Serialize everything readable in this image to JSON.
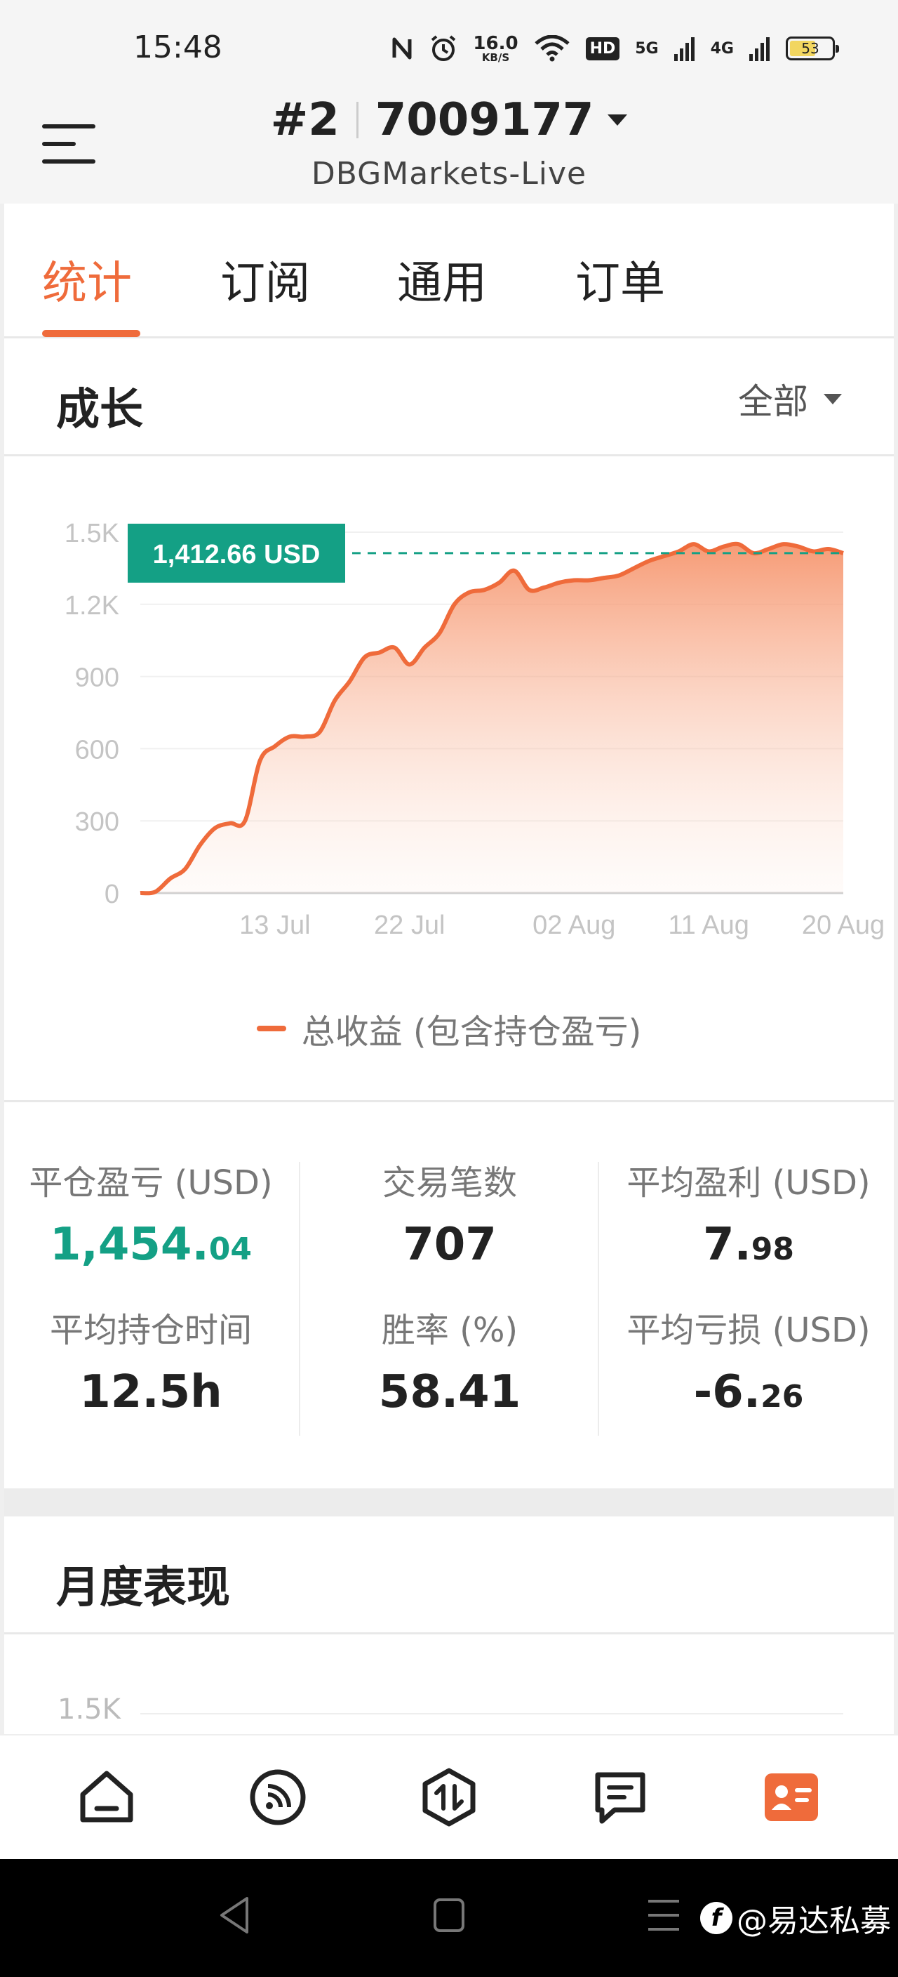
{
  "status_bar": {
    "time": "15:48",
    "net_speed_value": "16.0",
    "net_speed_unit": "KB/S",
    "hd_badge": "HD",
    "net_5g": "5G",
    "net_4g": "4G",
    "battery": "53",
    "icons": [
      "nfc-icon",
      "alarm-icon",
      "wifi-icon",
      "signal-icon",
      "battery-icon"
    ]
  },
  "header": {
    "account_index": "#2",
    "account_id": "7009177",
    "server": "DBGMarkets-Live"
  },
  "tabs": [
    {
      "label": "统计",
      "active": true
    },
    {
      "label": "订阅",
      "active": false
    },
    {
      "label": "通用",
      "active": false
    },
    {
      "label": "订单",
      "active": false
    }
  ],
  "growth": {
    "title": "成长",
    "filter": "全部",
    "legend": "总收益 (包含持仓盈亏)",
    "current_label": "1,412.66 USD"
  },
  "chart_data": {
    "type": "area",
    "title": "",
    "xlabel": "",
    "ylabel": "",
    "ylim": [
      0,
      1500
    ],
    "y_ticks": [
      "0",
      "300",
      "600",
      "900",
      "1.2K",
      "1.5K"
    ],
    "x_ticks": [
      "13 Jul",
      "22 Jul",
      "02 Aug",
      "11 Aug",
      "20 Aug"
    ],
    "grid": true,
    "accent_color": "#ef6b3b",
    "marker_color": "#14a085",
    "current_value": 1412.66,
    "series": [
      {
        "name": "总收益 (包含持仓盈亏)",
        "x": [
          "04 Jul",
          "05 Jul",
          "06 Jul",
          "07 Jul",
          "08 Jul",
          "09 Jul",
          "10 Jul",
          "11 Jul",
          "12 Jul",
          "13 Jul",
          "14 Jul",
          "15 Jul",
          "16 Jul",
          "17 Jul",
          "18 Jul",
          "19 Jul",
          "20 Jul",
          "21 Jul",
          "22 Jul",
          "23 Jul",
          "24 Jul",
          "25 Jul",
          "26 Jul",
          "27 Jul",
          "28 Jul",
          "29 Jul",
          "30 Jul",
          "31 Jul",
          "01 Aug",
          "02 Aug",
          "03 Aug",
          "04 Aug",
          "05 Aug",
          "06 Aug",
          "07 Aug",
          "08 Aug",
          "09 Aug",
          "10 Aug",
          "11 Aug",
          "12 Aug",
          "13 Aug",
          "14 Aug",
          "15 Aug",
          "16 Aug",
          "17 Aug",
          "18 Aug",
          "19 Aug",
          "20 Aug"
        ],
        "values": [
          0,
          5,
          60,
          100,
          200,
          270,
          290,
          300,
          550,
          610,
          650,
          650,
          670,
          800,
          880,
          980,
          1000,
          1020,
          950,
          1020,
          1080,
          1200,
          1250,
          1260,
          1290,
          1340,
          1260,
          1270,
          1290,
          1300,
          1300,
          1310,
          1320,
          1350,
          1380,
          1400,
          1420,
          1450,
          1420,
          1440,
          1450,
          1412.66,
          1430,
          1450,
          1440,
          1420,
          1430,
          1412.66
        ]
      }
    ]
  },
  "stats": {
    "closed_pl_label": "平仓盈亏 (USD)",
    "closed_pl_int": "1,454.",
    "closed_pl_frac": "04",
    "trades_label": "交易笔数",
    "trades_value": "707",
    "avg_profit_label": "平均盈利 (USD)",
    "avg_profit_int": "7.",
    "avg_profit_frac": "98",
    "avg_hold_label": "平均持仓时间",
    "avg_hold_value": "12.5h",
    "win_rate_label": "胜率 (%)",
    "win_rate_value": "58.41",
    "avg_loss_label": "平均亏损 (USD)",
    "avg_loss_int": "-6.",
    "avg_loss_frac": "26"
  },
  "monthly": {
    "title": "月度表现",
    "first_tick": "1.5K"
  },
  "bottom_nav": [
    "home-icon",
    "feed-icon",
    "trade-icon",
    "news-icon",
    "profile-icon"
  ],
  "watermark": "@易达私募"
}
